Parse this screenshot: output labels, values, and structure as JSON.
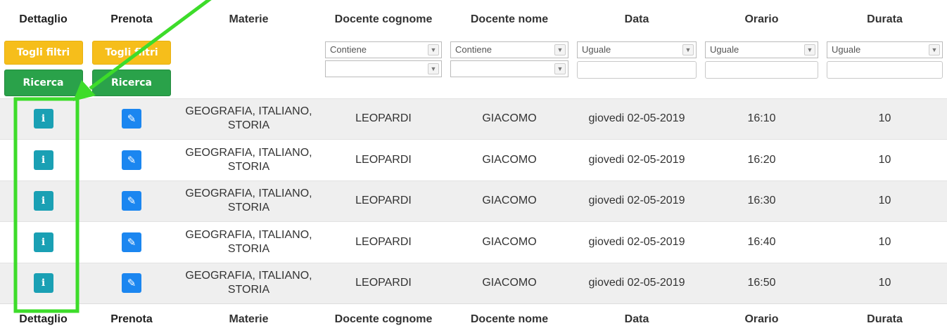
{
  "headers": [
    "Dettaglio",
    "Prenota",
    "Materie",
    "Docente cognome",
    "Docente nome",
    "Data",
    "Orario",
    "Durata"
  ],
  "filters": {
    "clear_label": "Togli filtri",
    "search_label": "Ricerca",
    "operators": {
      "docente_cognome": "Contiene",
      "docente_nome": "Contiene",
      "data": "Uguale",
      "orario": "Uguale",
      "durata": "Uguale"
    }
  },
  "rows": [
    {
      "materie_line1": "GEOGRAFIA, ITALIANO,",
      "materie_line2": "STORIA",
      "cognome": "LEOPARDI",
      "nome": "GIACOMO",
      "data": "giovedi 02-05-2019",
      "orario": "16:10",
      "durata": "10"
    },
    {
      "materie_line1": "GEOGRAFIA, ITALIANO,",
      "materie_line2": "STORIA",
      "cognome": "LEOPARDI",
      "nome": "GIACOMO",
      "data": "giovedi 02-05-2019",
      "orario": "16:20",
      "durata": "10"
    },
    {
      "materie_line1": "GEOGRAFIA, ITALIANO,",
      "materie_line2": "STORIA",
      "cognome": "LEOPARDI",
      "nome": "GIACOMO",
      "data": "giovedi 02-05-2019",
      "orario": "16:30",
      "durata": "10"
    },
    {
      "materie_line1": "GEOGRAFIA, ITALIANO,",
      "materie_line2": "STORIA",
      "cognome": "LEOPARDI",
      "nome": "GIACOMO",
      "data": "giovedi 02-05-2019",
      "orario": "16:40",
      "durata": "10"
    },
    {
      "materie_line1": "GEOGRAFIA, ITALIANO,",
      "materie_line2": "STORIA",
      "cognome": "LEOPARDI",
      "nome": "GIACOMO",
      "data": "giovedi 02-05-2019",
      "orario": "16:50",
      "durata": "10"
    }
  ],
  "icons": {
    "detail": "info-icon",
    "book": "edit-icon",
    "select_arrow": "chevron-down-icon"
  },
  "colors": {
    "warning": "#f6be1b",
    "success": "#2aa24a",
    "info": "#1aa0b4",
    "primary": "#1b86f0",
    "annotation": "#3ddc2a"
  }
}
